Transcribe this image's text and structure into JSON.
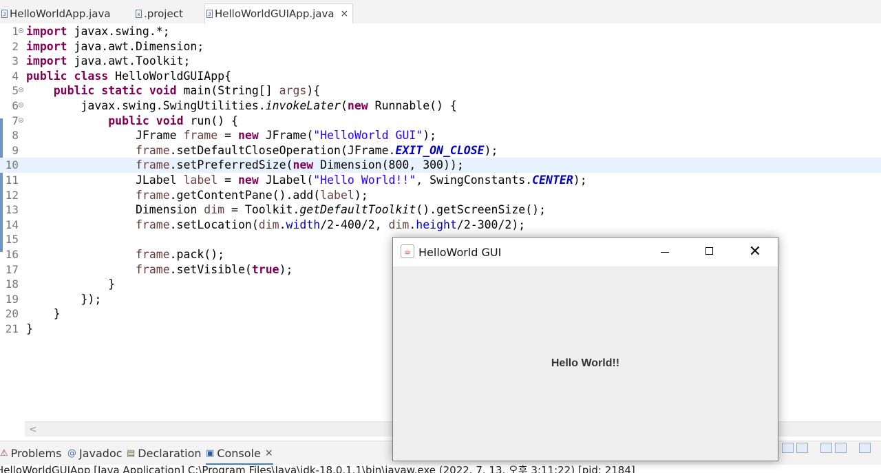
{
  "editor_tabs": [
    {
      "label": "HelloWorldApp.java"
    },
    {
      "label": ".project"
    },
    {
      "label": "HelloWorldGUIApp.java",
      "close": "×"
    }
  ],
  "code_lines": [
    {
      "n": "1",
      "html": "<span class=\"kw\">import</span> javax.swing.*;"
    },
    {
      "n": "2",
      "html": "<span class=\"kw\">import</span> java.awt.Dimension;"
    },
    {
      "n": "3",
      "html": "<span class=\"kw\">import</span> java.awt.Toolkit;"
    },
    {
      "n": "4",
      "html": "<span class=\"kw\">public</span> <span class=\"kw\">class</span> HelloWorldGUIApp{"
    },
    {
      "n": "5",
      "html": "    <span class=\"kw\">public</span> <span class=\"kw\">static</span> <span class=\"kw\">void</span> main(String[] <span class=\"var\">args</span>){"
    },
    {
      "n": "6",
      "html": "        javax.swing.SwingUtilities.<span class=\"ital\">invokeLater</span>(<span class=\"kw\">new</span> Runnable() {"
    },
    {
      "n": "7",
      "html": "            <span class=\"kw\">public</span> <span class=\"kw\">void</span> run() {"
    },
    {
      "n": "8",
      "html": "                JFrame <span class=\"var\">frame</span> = <span class=\"kw\">new</span> JFrame(<span class=\"str\">\"HelloWorld GUI\"</span>);"
    },
    {
      "n": "9",
      "html": "                <span class=\"var\">frame</span>.setDefaultCloseOperation(JFrame.<span class=\"sfld\">EXIT_ON_CLOSE</span>);"
    },
    {
      "n": "10",
      "html": "                <span class=\"var\">frame</span>.setPreferredSize(<span class=\"kw\">new</span> Dimension(800, 300));"
    },
    {
      "n": "11",
      "html": "                JLabel <span class=\"var\">label</span> = <span class=\"kw\">new</span> JLabel(<span class=\"str\">\"Hello World!!\"</span>, SwingConstants.<span class=\"sfld\">CENTER</span>);"
    },
    {
      "n": "12",
      "html": "                <span class=\"var\">frame</span>.getContentPane().add(<span class=\"var\">label</span>);"
    },
    {
      "n": "13",
      "html": "                Dimension <span class=\"var\">dim</span> = Toolkit.<span class=\"ital\">getDefaultToolkit</span>().getScreenSize();"
    },
    {
      "n": "14",
      "html": "                <span class=\"var\">frame</span>.setLocation(<span class=\"var\">dim</span>.<span class=\"fld\">width</span>/2-400/2, <span class=\"var\">dim</span>.<span class=\"fld\">height</span>/2-300/2);"
    },
    {
      "n": "15",
      "html": ""
    },
    {
      "n": "16",
      "html": "                <span class=\"var\">frame</span>.pack();"
    },
    {
      "n": "17",
      "html": "                <span class=\"var\">frame</span>.setVisible(<span class=\"kw\">true</span>);"
    },
    {
      "n": "18",
      "html": "            }"
    },
    {
      "n": "19",
      "html": "        });"
    },
    {
      "n": "20",
      "html": "    }"
    },
    {
      "n": "21",
      "html": "}"
    }
  ],
  "scroll_left_arrow": "<",
  "panel_tabs": [
    {
      "label": "Problems",
      "icon": "problems-icon",
      "glyph": "⚠"
    },
    {
      "label": "Javadoc",
      "icon": "javadoc-icon",
      "glyph": "@"
    },
    {
      "label": "Declaration",
      "icon": "declaration-icon",
      "glyph": "▤"
    },
    {
      "label": "Console",
      "icon": "console-icon",
      "glyph": "▣",
      "close": "×"
    }
  ],
  "console_status": "HelloWorldGUIApp [Java Application] C:\\Program Files\\Java\\jdk-18.0.1.1\\bin\\javaw.exe  (2022. 7. 13. 오후 3:11:22) [pid: 2184]",
  "swing_window": {
    "title": "HelloWorld GUI",
    "label": "Hello World!!",
    "close_glyph": "✕"
  },
  "colors": {
    "keyword": "#7f0055",
    "string": "#2a00ff",
    "field": "#0000c0",
    "current_line": "#e8f2fe"
  }
}
